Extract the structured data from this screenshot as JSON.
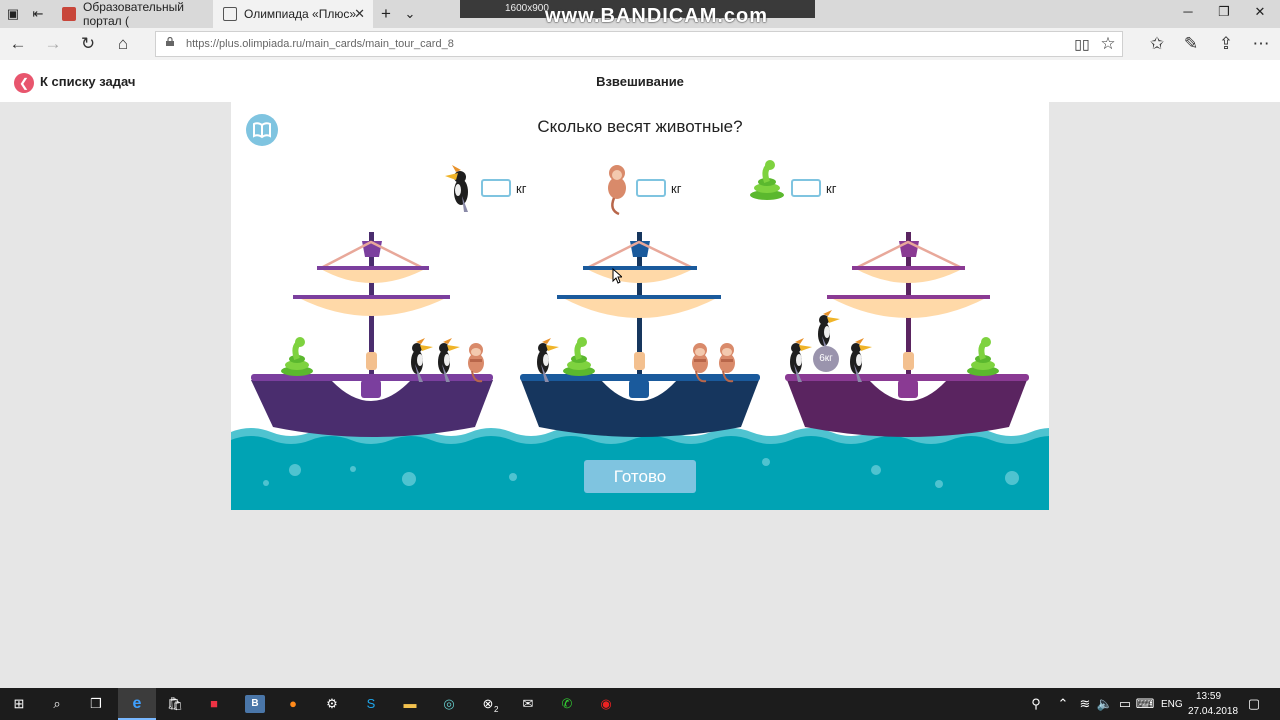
{
  "browser": {
    "tabs": [
      {
        "title": "Образовательный портал (",
        "active": false
      },
      {
        "title": "Олимпиада «Плюс»",
        "active": true
      }
    ],
    "new_tab": "+",
    "tab_list": "⌄",
    "url": "https://plus.olimpiada.ru/main_cards/main_tour_card_8",
    "recording_overlay": {
      "watermark": "www.BANDICAM.com",
      "resolution": "1600x900"
    }
  },
  "page": {
    "back_label": "К списку задач",
    "title": "Взвешивание",
    "question": "Сколько весят животные?",
    "answers": [
      {
        "animal": "hornbill-bird",
        "value": "",
        "unit": "кг"
      },
      {
        "animal": "monkey",
        "value": "",
        "unit": "кг"
      },
      {
        "animal": "snake",
        "value": "",
        "unit": "кг"
      }
    ],
    "known_weight_label": "6кг",
    "submit_label": "Готово",
    "colors": {
      "accent": "#7fc4e0",
      "back": "#e8556d",
      "sea": "#00a3b4",
      "boat1": "#4a2d6e",
      "boat2": "#16365e",
      "boat3": "#5a2460",
      "sail": "#ffd9a8"
    }
  },
  "taskbar": {
    "language": "ENG",
    "time": "13:59",
    "date": "27.04.2018",
    "xbox_badge": "2"
  }
}
